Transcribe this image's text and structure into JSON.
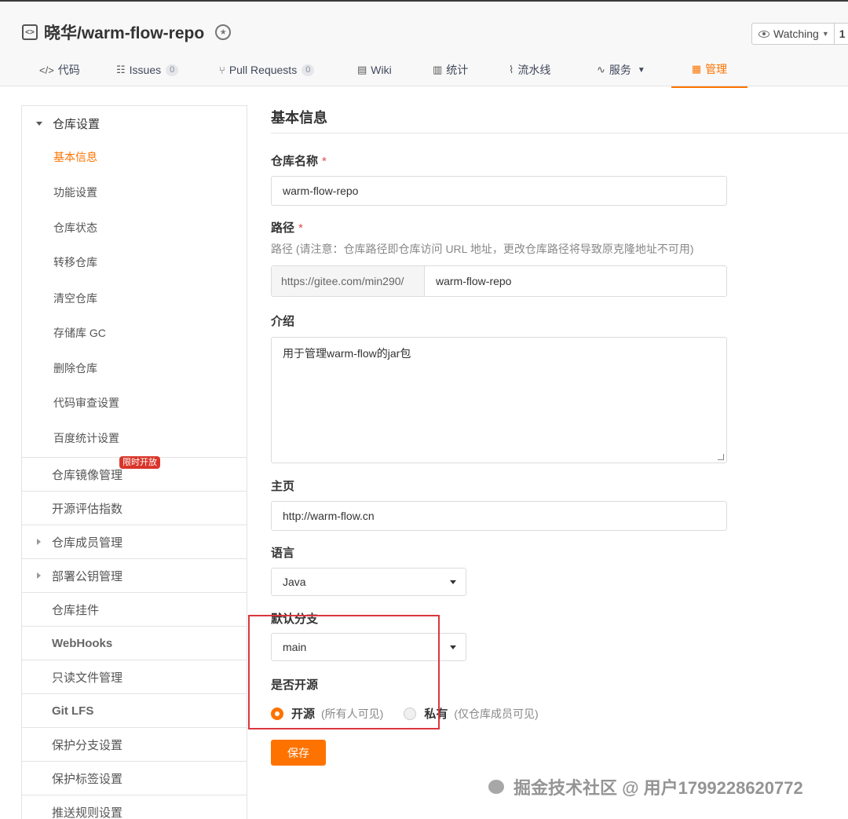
{
  "repo": {
    "title": "晓华/warm-flow-repo"
  },
  "watch": {
    "label": "Watching",
    "count": "1"
  },
  "tabs": [
    {
      "label": "代码"
    },
    {
      "label": "Issues",
      "count": "0"
    },
    {
      "label": "Pull Requests",
      "count": "0"
    },
    {
      "label": "Wiki"
    },
    {
      "label": "统计"
    },
    {
      "label": "流水线"
    },
    {
      "label": "服务"
    },
    {
      "label": "管理"
    }
  ],
  "sidebar": {
    "group_title": "仓库设置",
    "sub_items": [
      "基本信息",
      "功能设置",
      "仓库状态",
      "转移仓库",
      "清空仓库",
      "存储库 GC",
      "删除仓库",
      "代码审查设置",
      "百度统计设置"
    ],
    "items": [
      "仓库镜像管理",
      "开源评估指数",
      "仓库成员管理",
      "部署公钥管理",
      "仓库挂件",
      "WebHooks",
      "只读文件管理",
      "Git LFS",
      "保护分支设置",
      "保护标签设置",
      "推送规则设置"
    ],
    "mirror_tag": "限时开放"
  },
  "main": {
    "section_title": "基本信息",
    "name_label": "仓库名称",
    "name_value": "warm-flow-repo",
    "path_label": "路径",
    "path_hint": "路径 (请注意：仓库路径即仓库访问 URL 地址，更改仓库路径将导致原克隆地址不可用)",
    "path_prefix": "https://gitee.com/min290/",
    "path_value": "warm-flow-repo",
    "intro_label": "介绍",
    "intro_value": "用于管理warm-flow的jar包",
    "homepage_label": "主页",
    "homepage_value": "http://warm-flow.cn",
    "language_label": "语言",
    "language_value": "Java",
    "branch_label": "默认分支",
    "branch_value": "main",
    "open_label": "是否开源",
    "open_option": "开源",
    "open_desc": "(所有人可见)",
    "private_option": "私有",
    "private_desc": "(仅仓库成员可见)",
    "save_label": "保存"
  },
  "watermark": "掘金技术社区 @ 用户1799228620772",
  "colors": {
    "accent": "#fe7300",
    "highlight": "#d9363e",
    "required": "#e04b4b"
  }
}
